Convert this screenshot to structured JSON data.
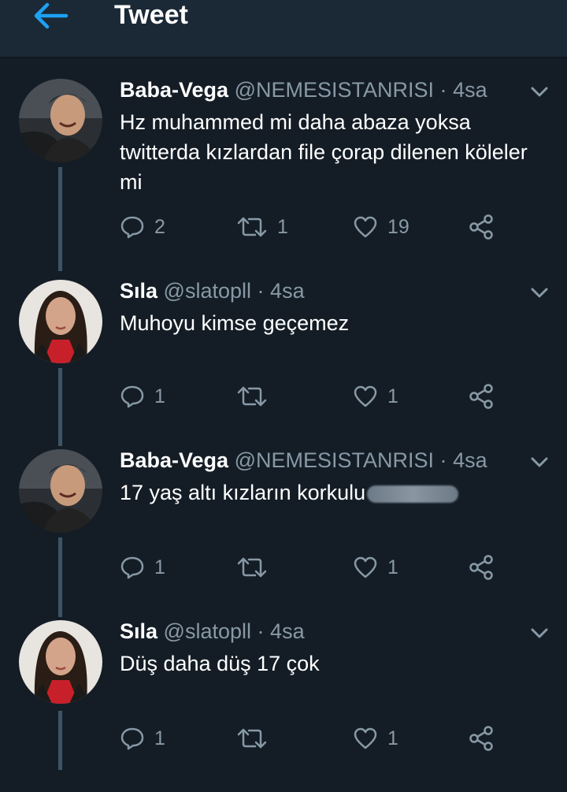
{
  "header": {
    "title": "Tweet"
  },
  "tweets": [
    {
      "name": "Baba-Vega",
      "handle": "@NEMESISTANRISI",
      "separator": "·",
      "time": "4sa",
      "text": "Hz muhammed mi daha abaza yoksa twitterda kızlardan file çorap dilenen köleler mi",
      "reply_count": "2",
      "retweet_count": "1",
      "like_count": "19"
    },
    {
      "name": "Sıla",
      "handle": "@slatopll",
      "separator": "·",
      "time": "4sa",
      "text": "Muhoyu kimse geçemez",
      "reply_count": "1",
      "retweet_count": "",
      "like_count": "1"
    },
    {
      "name": "Baba-Vega",
      "handle": "@NEMESISTANRISI",
      "separator": "·",
      "time": "4sa",
      "text": "17 yaş altı kızların korkulu",
      "reply_count": "1",
      "retweet_count": "",
      "like_count": "1"
    },
    {
      "name": "Sıla",
      "handle": "@slatopll",
      "separator": "·",
      "time": "4sa",
      "text": "Düş daha düş 17 çok",
      "reply_count": "1",
      "retweet_count": "",
      "like_count": "1"
    }
  ],
  "colors": {
    "background": "#141d26",
    "header": "#1b2836",
    "accent": "#1da1f2",
    "muted": "#8899a6"
  },
  "icons": [
    "back-arrow-icon",
    "chevron-down-icon",
    "reply-icon",
    "retweet-icon",
    "like-icon",
    "share-icon"
  ]
}
